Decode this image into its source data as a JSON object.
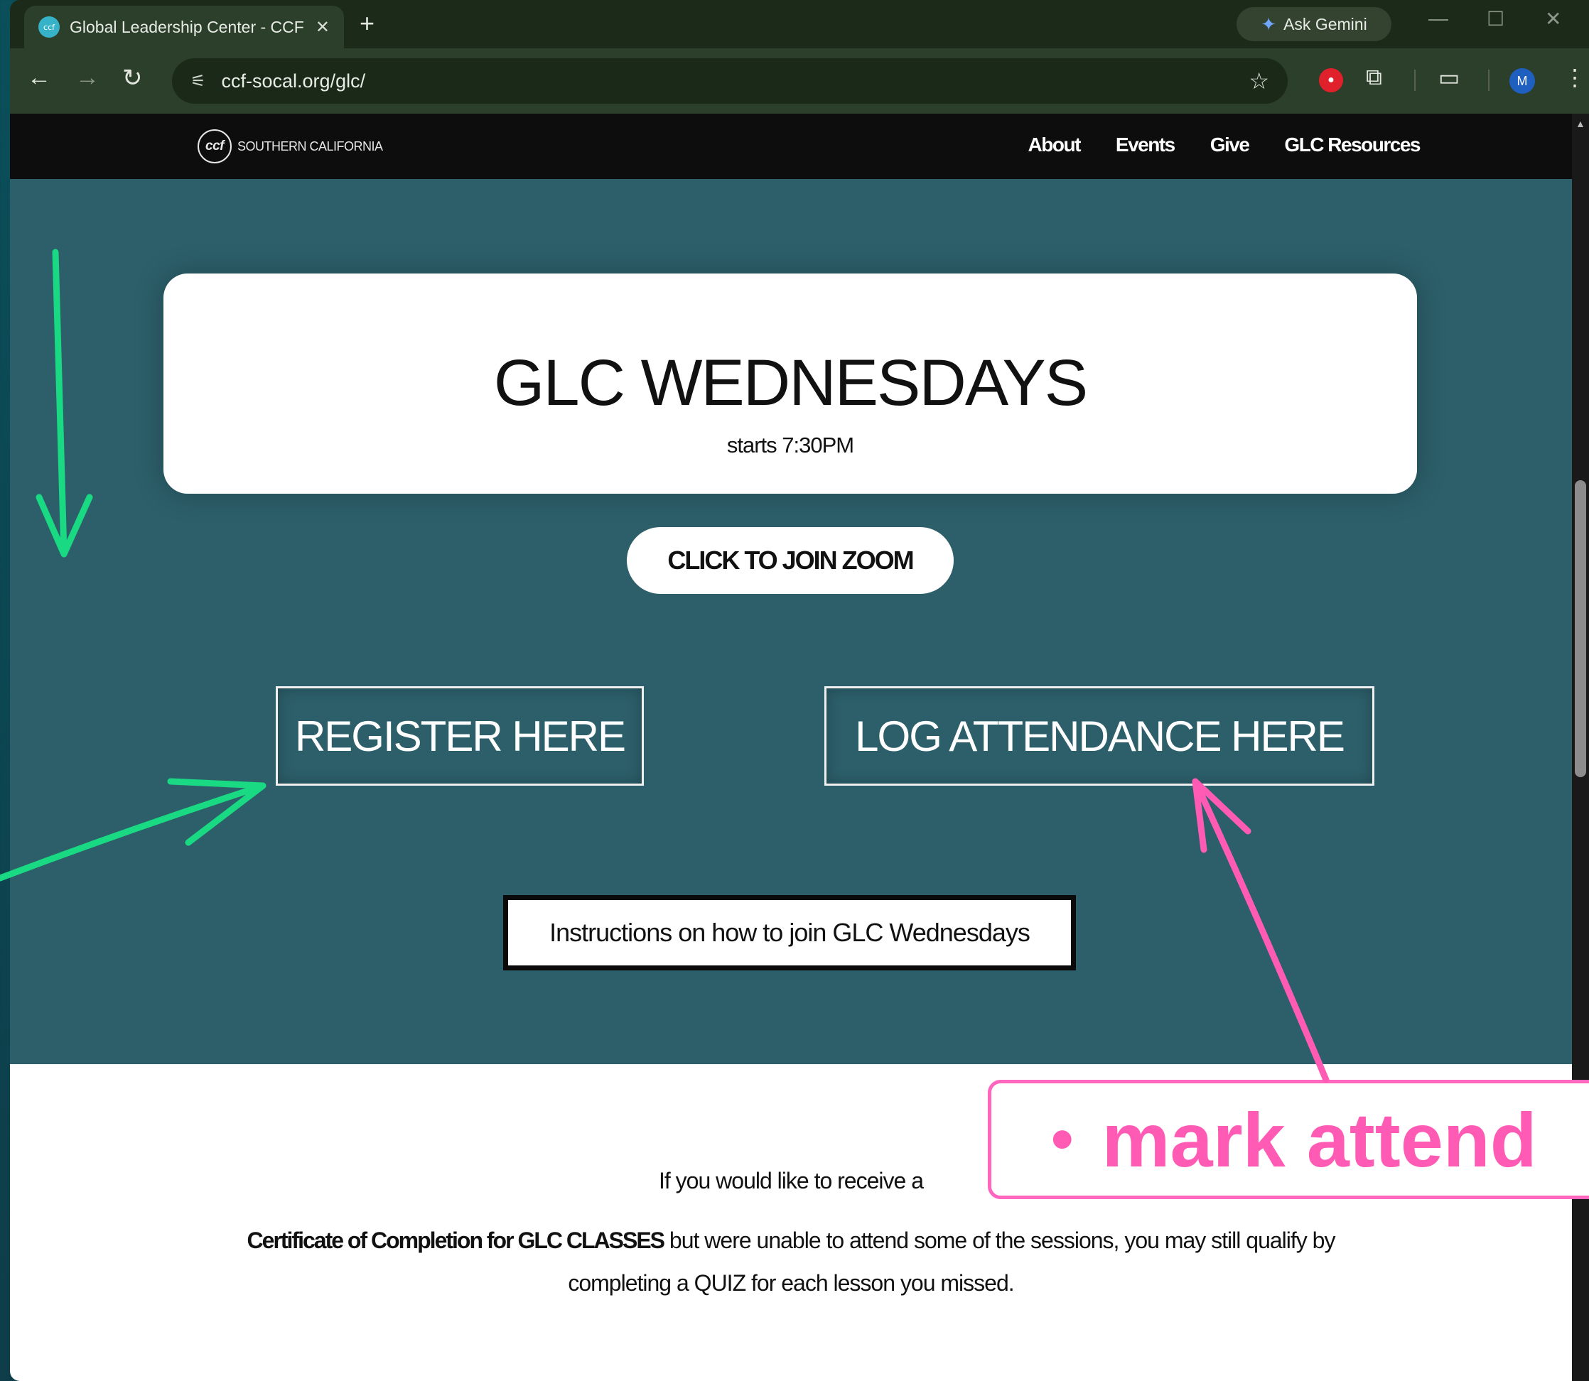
{
  "browser": {
    "tab_title": "Global Leadership Center - CCF",
    "tab_close": "✕",
    "new_tab": "+",
    "gemini_label": "Ask Gemini",
    "url": "ccf-socal.org/glc/",
    "avatar_initial": "M",
    "favicon_text": "ccf"
  },
  "site": {
    "logo_mark": "ccf",
    "logo_text": "SOUTHERN CALIFORNIA",
    "nav": [
      "About",
      "Events",
      "Give",
      "GLC Resources"
    ]
  },
  "hero": {
    "title": "GLC WEDNESDAYS",
    "subtitle": "starts 7:30PM"
  },
  "buttons": {
    "zoom": "CLICK TO JOIN ZOOM",
    "register": "REGISTER HERE",
    "log_attendance": "LOG ATTENDANCE HERE",
    "instructions": "Instructions on how to join GLC Wednesdays"
  },
  "info": {
    "line1": "If you would like to receive a",
    "line2_bold": "Certificate of Completion for GLC CLASSES",
    "line2_rest": " but were unable to attend some of the sessions, you may still qualify by",
    "line3": "completing a QUIZ for each lesson you missed."
  },
  "annotation": {
    "bullet": "•",
    "text": "mark attend"
  },
  "colors": {
    "page_bg": "#2c5f6a",
    "green_arrow": "#19d983",
    "pink_arrow": "#ff5bb5"
  }
}
